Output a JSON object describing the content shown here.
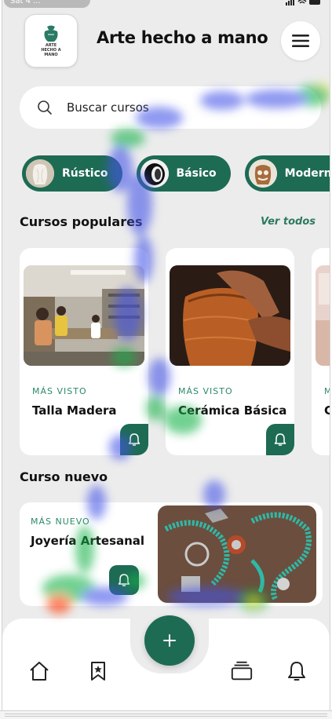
{
  "status_bar": {
    "time": "Sat 4 ..."
  },
  "header": {
    "logo_text_lines": [
      "ARTE",
      "HECHO A",
      "MANO"
    ],
    "title": "Arte hecho a mano",
    "menu_icon": "hamburger-menu-icon"
  },
  "search": {
    "icon": "search-icon",
    "placeholder": "Buscar cursos"
  },
  "categories": [
    {
      "label": "Rústico",
      "thumb": "white-vase"
    },
    {
      "label": "Básico",
      "thumb": "black-white-pot"
    },
    {
      "label": "Moderno",
      "thumb": "decorated-vessel"
    }
  ],
  "popular": {
    "title": "Cursos populares",
    "see_all": "Ver todos",
    "cards": [
      {
        "tag": "MÁS VISTO",
        "name": "Talla Madera",
        "image": "woodworking-workshop-photo"
      },
      {
        "tag": "MÁS VISTO",
        "name": "Cerámica Básica",
        "image": "pottery-wheel-photo"
      },
      {
        "tag": "MÁ",
        "name": "Ce",
        "image": "pottery-pink-photo"
      }
    ]
  },
  "new_course": {
    "title": "Curso nuevo",
    "tag": "MÁS NUEVO",
    "name": "Joyería Artesanal",
    "image": "turquoise-jewelry-photo"
  },
  "bottom_nav": {
    "items": [
      "home-icon",
      "bookmark-star-icon",
      "add-icon",
      "collection-icon",
      "bell-icon"
    ],
    "fab_label": "+"
  },
  "colors": {
    "primary_green": "#1e6b54",
    "accent_green": "#2d8a68",
    "background": "#ececec"
  }
}
